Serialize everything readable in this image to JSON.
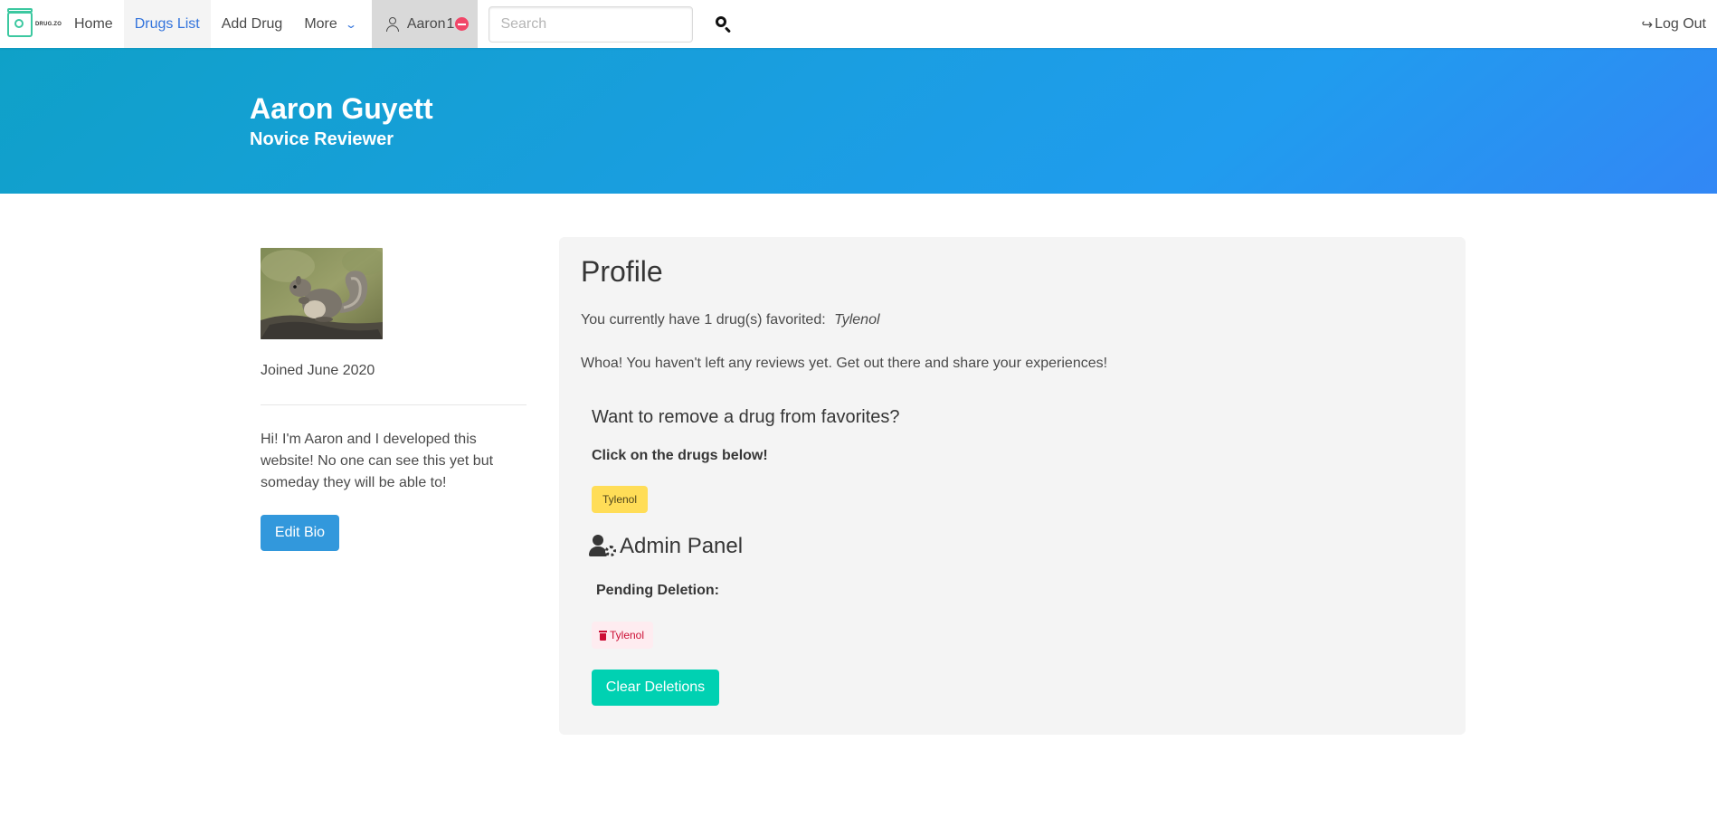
{
  "nav": {
    "brand_text": "DRUG.ZO",
    "items": [
      {
        "label": "Home",
        "active": false
      },
      {
        "label": "Drugs List",
        "active": true
      },
      {
        "label": "Add Drug",
        "active": false
      }
    ],
    "more_label": "More",
    "user_label": "Aaron",
    "notification_count": "1",
    "search_placeholder": "Search",
    "search_value": "",
    "logout_label": "Log Out"
  },
  "hero": {
    "name": "Aaron Guyett",
    "rank": "Novice Reviewer"
  },
  "sidebar": {
    "joined": "Joined June 2020",
    "bio": "Hi! I'm Aaron and I developed this website! No one can see this yet but someday they will be able to!",
    "edit_bio_label": "Edit Bio"
  },
  "profile": {
    "title": "Profile",
    "favorites_text": "You currently have 1 drug(s) favorited:",
    "favorites_list": "Tylenol",
    "reviews_text": "Whoa! You haven't left any reviews yet. Get out there and share your experiences!",
    "remove_heading": "Want to remove a drug from favorites?",
    "click_instruction": "Click on the drugs below!",
    "favorite_tags": [
      "Tylenol"
    ],
    "admin_heading": "Admin Panel",
    "pending_label": "Pending Deletion:",
    "pending_tags": [
      "Tylenol"
    ],
    "clear_label": "Clear Deletions"
  },
  "colors": {
    "hero_gradient_start": "#0fa1c8",
    "hero_gradient_end": "#3287f5",
    "link_active": "#3273dc",
    "edit_button": "#3298dc",
    "clear_button": "#00d1b2",
    "favorite_tag": "#ffdd57",
    "pending_tag_bg": "#feecf0",
    "pending_tag_text": "#cc0f35",
    "notification": "#f14668"
  },
  "icons": {
    "brand": "drugzo-logo",
    "more": "chevron-down-icon",
    "user": "user-icon",
    "notification": "minus-circle-icon",
    "search": "search-icon",
    "logout": "sign-out-icon",
    "admin": "user-cog-icon",
    "trash": "trash-icon"
  }
}
